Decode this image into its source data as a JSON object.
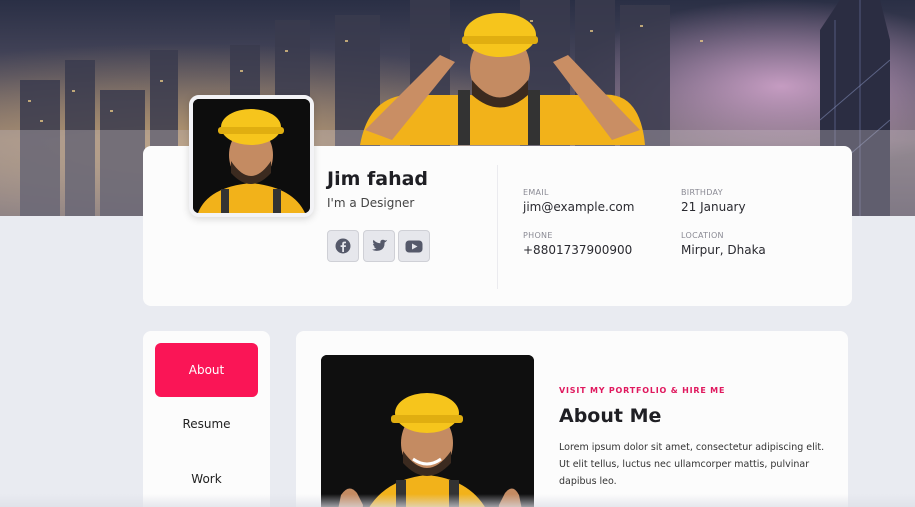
{
  "profile": {
    "name": "Jim fahad",
    "role": "I'm a Designer",
    "social": [
      {
        "icon": "facebook-icon"
      },
      {
        "icon": "twitter-icon"
      },
      {
        "icon": "youtube-icon"
      }
    ]
  },
  "info": {
    "email_label": "EMAIL",
    "email": "jim@example.com",
    "birthday_label": "BIRTHDAY",
    "birthday": "21 January",
    "phone_label": "PHONE",
    "phone": "+8801737900900",
    "location_label": "LOCATION",
    "location": "Mirpur, Dhaka"
  },
  "nav": {
    "items": [
      {
        "label": "About"
      },
      {
        "label": "Resume"
      },
      {
        "label": "Work"
      }
    ],
    "active_color": "#fa1556"
  },
  "about": {
    "kicker": "VISIT MY PORTFOLIO & HIRE ME",
    "title": "About Me",
    "text": "Lorem ipsum dolor sit amet, consectetur adipiscing elit. Ut elit tellus, luctus nec ullamcorper mattis, pulvinar dapibus leo."
  },
  "colors": {
    "accent": "#fa1556",
    "kicker": "#e0185e",
    "background": "#e9ebf1",
    "card": "#fcfcfc",
    "helmet": "#f4c21a"
  }
}
